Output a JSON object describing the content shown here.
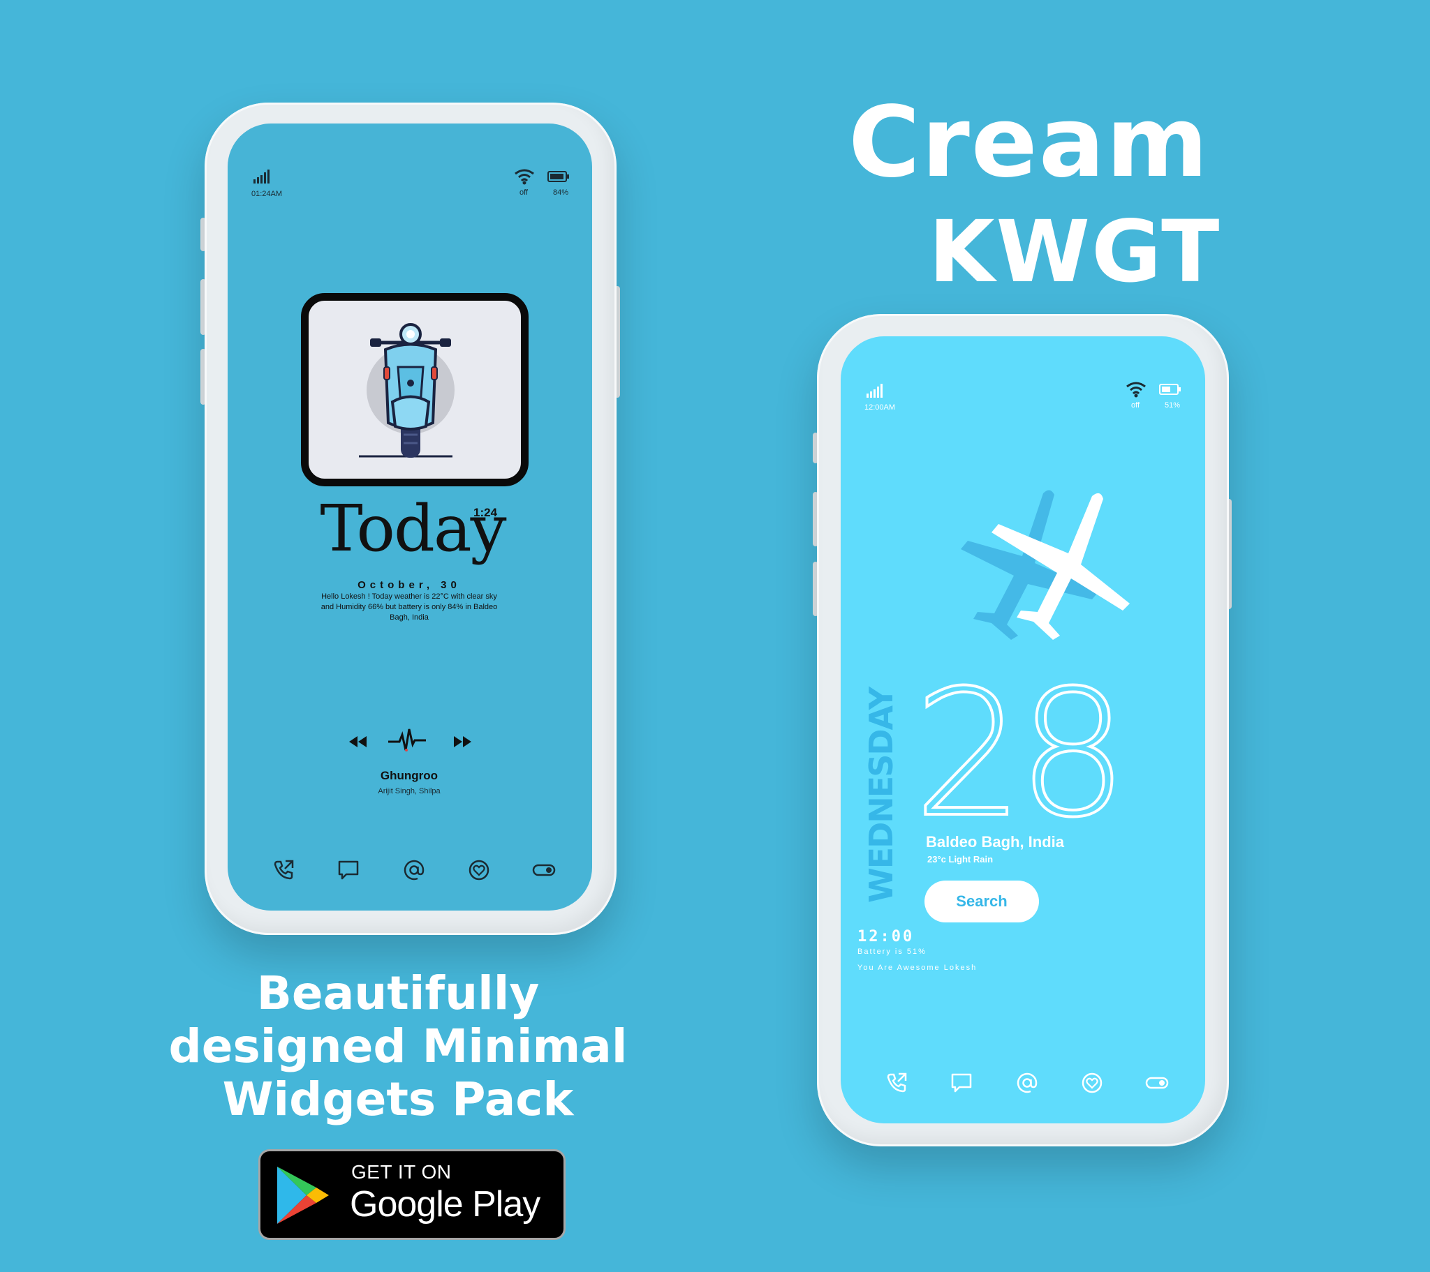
{
  "promo": {
    "title_line1": "Cream",
    "title_line2": "KWGT",
    "tagline_line1": "Beautifully",
    "tagline_line2": "designed Minimal",
    "tagline_line3": "Widgets Pack",
    "badge_small": "GET IT ON",
    "badge_big": "Google Play"
  },
  "phone_left": {
    "status": {
      "time": "01:24AM",
      "wifi": "off",
      "battery": "84%"
    },
    "widget_title": "Today",
    "clock": "1:24",
    "date": "October, 30",
    "message_line1": "Hello Lokesh ! Today weather is 22°C with clear sky",
    "message_line2": "and Humidity 66% but battery is only 84% in Baldeo",
    "message_line3": "Bagh, India",
    "song_title": "Ghungroo",
    "song_artist": "Arijit Singh, Shilpa"
  },
  "phone_right": {
    "status": {
      "time": "12:00AM",
      "wifi": "off",
      "battery": "51%"
    },
    "weekday": "WEDNESDAY",
    "day_number": "28",
    "location": "Baldeo Bagh, India",
    "weather": "23°c Light Rain",
    "search_label": "Search",
    "clock": "12:00",
    "battery_line": "Battery is 51%",
    "greeting": "You Are Awesome Lokesh"
  },
  "dock_icons": [
    "phone-icon",
    "message-icon",
    "at-icon",
    "heart-icon",
    "toggle-icon"
  ],
  "colors": {
    "background": "#45b6d9",
    "left_screen": "#47b4d6",
    "right_screen": "#5fdcfc",
    "right_accent": "#36b7e8"
  }
}
